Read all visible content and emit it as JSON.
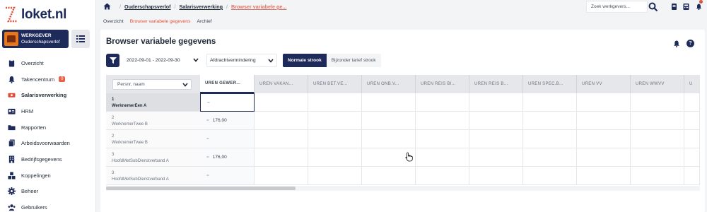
{
  "app": {
    "logo_text": "loket.nl"
  },
  "employer": {
    "role": "WERKGEVER",
    "name": "Ouderschapsverlof"
  },
  "sidebar": {
    "items": [
      {
        "label": "Overzicht",
        "icon": "clipboard-icon"
      },
      {
        "label": "Takencentrum",
        "icon": "bell-icon",
        "badge": "0"
      },
      {
        "label": "Salarisverwerking",
        "icon": "money-icon",
        "active": true
      },
      {
        "label": "HRM",
        "icon": "id-card-icon"
      },
      {
        "label": "Rapporten",
        "icon": "folder-icon"
      },
      {
        "label": "Arbeidsvoorwaarden",
        "icon": "documents-icon"
      },
      {
        "label": "Bedrijfsgegevens",
        "icon": "building-icon"
      },
      {
        "label": "Koppelingen",
        "icon": "cubes-icon"
      },
      {
        "label": "Beheer",
        "icon": "gear-icon"
      },
      {
        "label": "Gebruikers",
        "icon": "users-icon"
      }
    ]
  },
  "breadcrumb": {
    "items": [
      "Ouderschapsverlof",
      "Salarisverwerking"
    ],
    "current": "Browser variabele ge..."
  },
  "search": {
    "placeholder": "Zoek werkgevers..."
  },
  "subtabs": {
    "items": [
      {
        "label": "Overzicht"
      },
      {
        "label": "Browser variabele gegevens",
        "active": true
      },
      {
        "label": "Archief"
      }
    ]
  },
  "page": {
    "title": "Browser variabele gegevens",
    "help": "?"
  },
  "filters": {
    "period": "2022-09-01 - 2022-09-30",
    "type": "Afdrachtvermindering",
    "toggle_on": "Normale strook",
    "toggle_off": "Bijzonder tarief strook"
  },
  "grid": {
    "row_filter_placeholder": "Persnr, naam",
    "columns": [
      "UREN GEWER...",
      "UREN VAKAN...",
      "UREN BET.VE...",
      "UREN ONB.V...",
      "UREN REIS BI...",
      "UREN REIS B...",
      "UREN SPEC.B...",
      "UREN VV",
      "UREN WWVV",
      "U"
    ],
    "rows": [
      {
        "num": "1",
        "name": "WerknemerEen A",
        "value": ""
      },
      {
        "num": "2",
        "name": "WerknemerTwee B",
        "value": "176,00"
      },
      {
        "num": "2",
        "name": "WerknemerTwee B",
        "value": ""
      },
      {
        "num": "3",
        "name": "HoofdMetSubDienstverband A",
        "value": "176,00"
      },
      {
        "num": "3",
        "name": "HoofdMetSubDienstverband A",
        "value": ""
      }
    ],
    "eq_symbol": "="
  },
  "colors": {
    "navy": "#1e2a5a",
    "accent": "#e0503a",
    "link_current": "#e07368"
  }
}
